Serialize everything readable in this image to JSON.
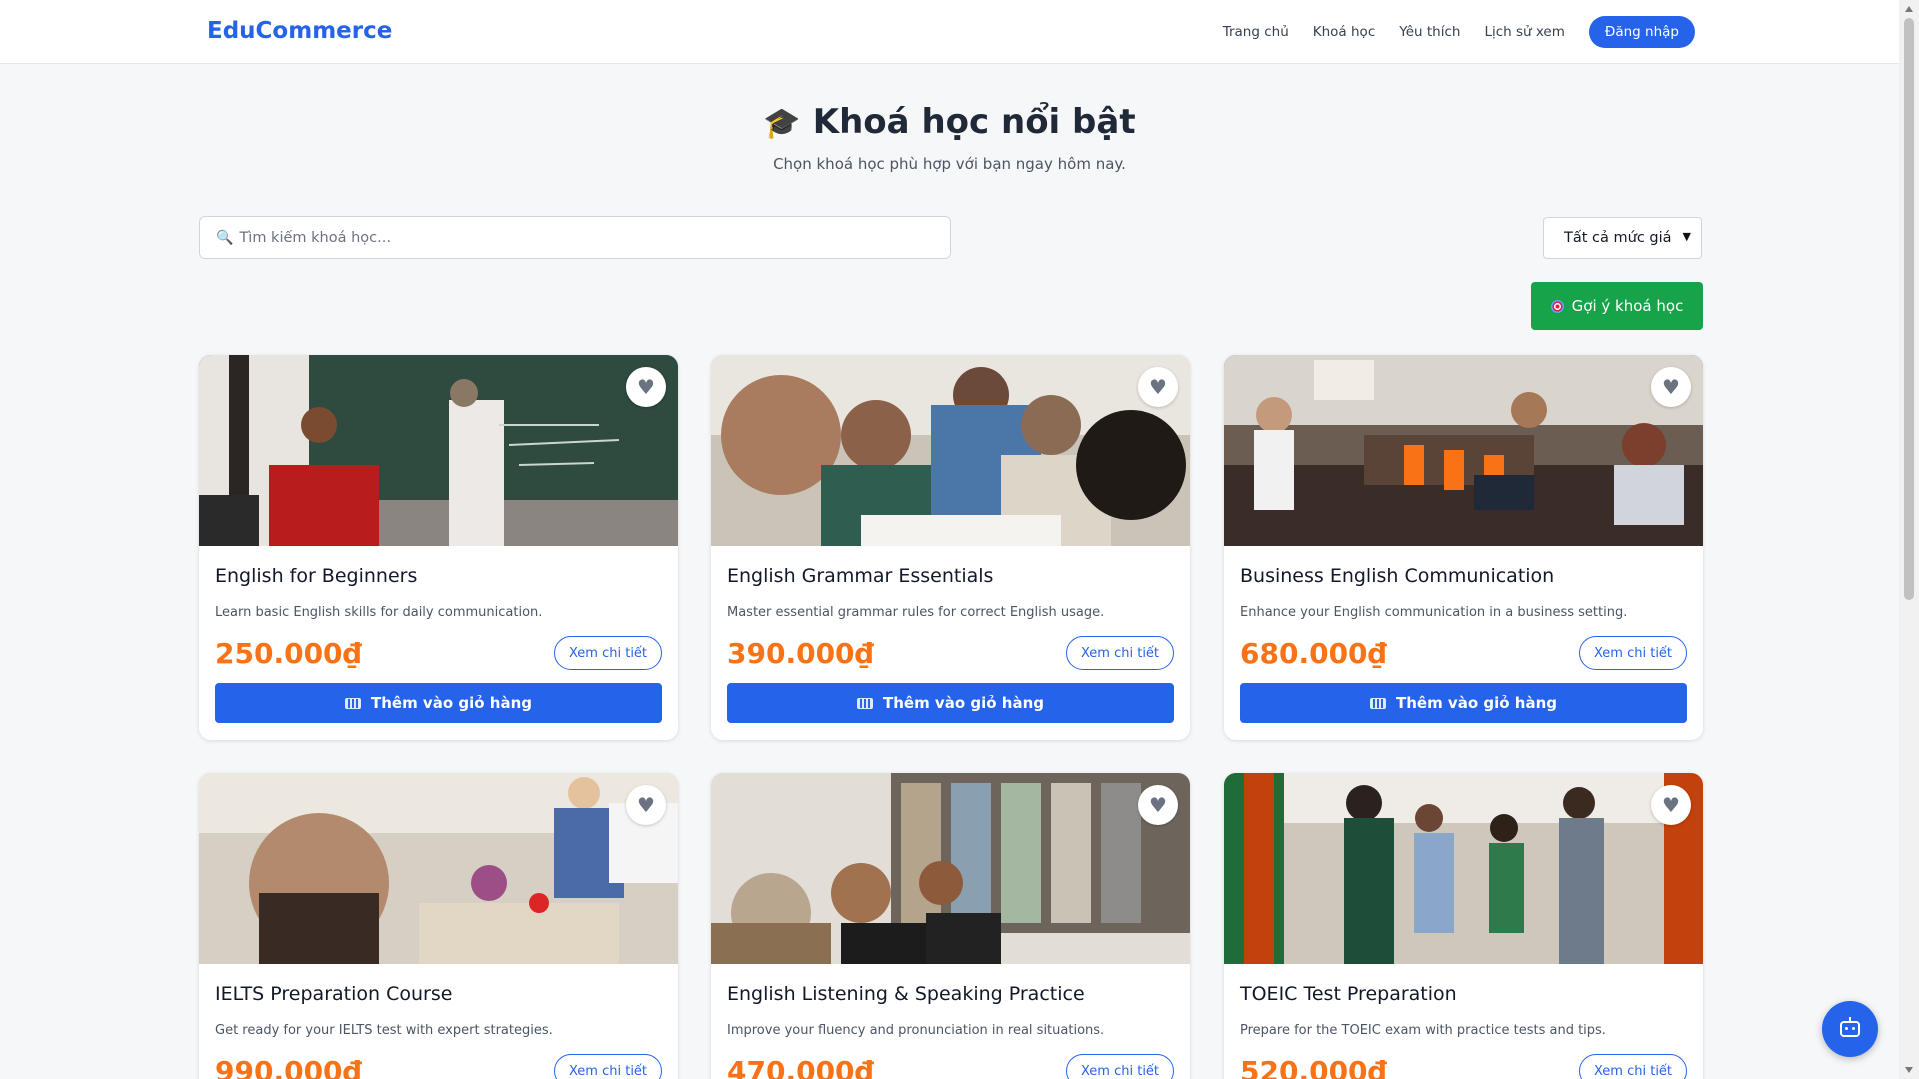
{
  "header": {
    "brand": "EduCommerce",
    "nav": [
      "Trang chủ",
      "Khoá học",
      "Yêu thích",
      "Lịch sử xem"
    ],
    "login_label": "Đăng nhập"
  },
  "hero": {
    "title": "Khoá học nổi bật",
    "subtitle": "Chọn khoá học phù hợp với bạn ngay hôm nay."
  },
  "filters": {
    "search_placeholder": "Tìm kiếm khoá học...",
    "price_filter_selected": "Tất cả mức giá",
    "suggest_label": "Gợi ý khoá học"
  },
  "courses": [
    {
      "title": "English for Beginners",
      "description": "Learn basic English skills for daily communication.",
      "price": "250.000₫",
      "detail_label": "Xem chi tiết",
      "cart_label": "Thêm vào giỏ hàng"
    },
    {
      "title": "English Grammar Essentials",
      "description": "Master essential grammar rules for correct English usage.",
      "price": "390.000₫",
      "detail_label": "Xem chi tiết",
      "cart_label": "Thêm vào giỏ hàng"
    },
    {
      "title": "Business English Communication",
      "description": "Enhance your English communication in a business setting.",
      "price": "680.000₫",
      "detail_label": "Xem chi tiết",
      "cart_label": "Thêm vào giỏ hàng"
    },
    {
      "title": "IELTS Preparation Course",
      "description": "Get ready for your IELTS test with expert strategies.",
      "price": "990.000₫",
      "detail_label": "Xem chi tiết"
    },
    {
      "title": "English Listening & Speaking Practice",
      "description": "Improve your fluency and pronunciation in real situations.",
      "price": "470.000₫",
      "detail_label": "Xem chi tiết"
    },
    {
      "title": "TOEIC Test Preparation",
      "description": "Prepare for the TOEIC exam with practice tests and tips.",
      "price": "520.000₫",
      "detail_label": "Xem chi tiết"
    }
  ],
  "icons": {
    "favorite": "heart-icon",
    "search": "search-icon",
    "chat": "chatbot-icon",
    "cart": "keyboard-icon",
    "hero": "graduation-cap-icon"
  },
  "colors": {
    "primary": "#2563eb",
    "price": "#f97316",
    "suggest": "#16a34a"
  }
}
